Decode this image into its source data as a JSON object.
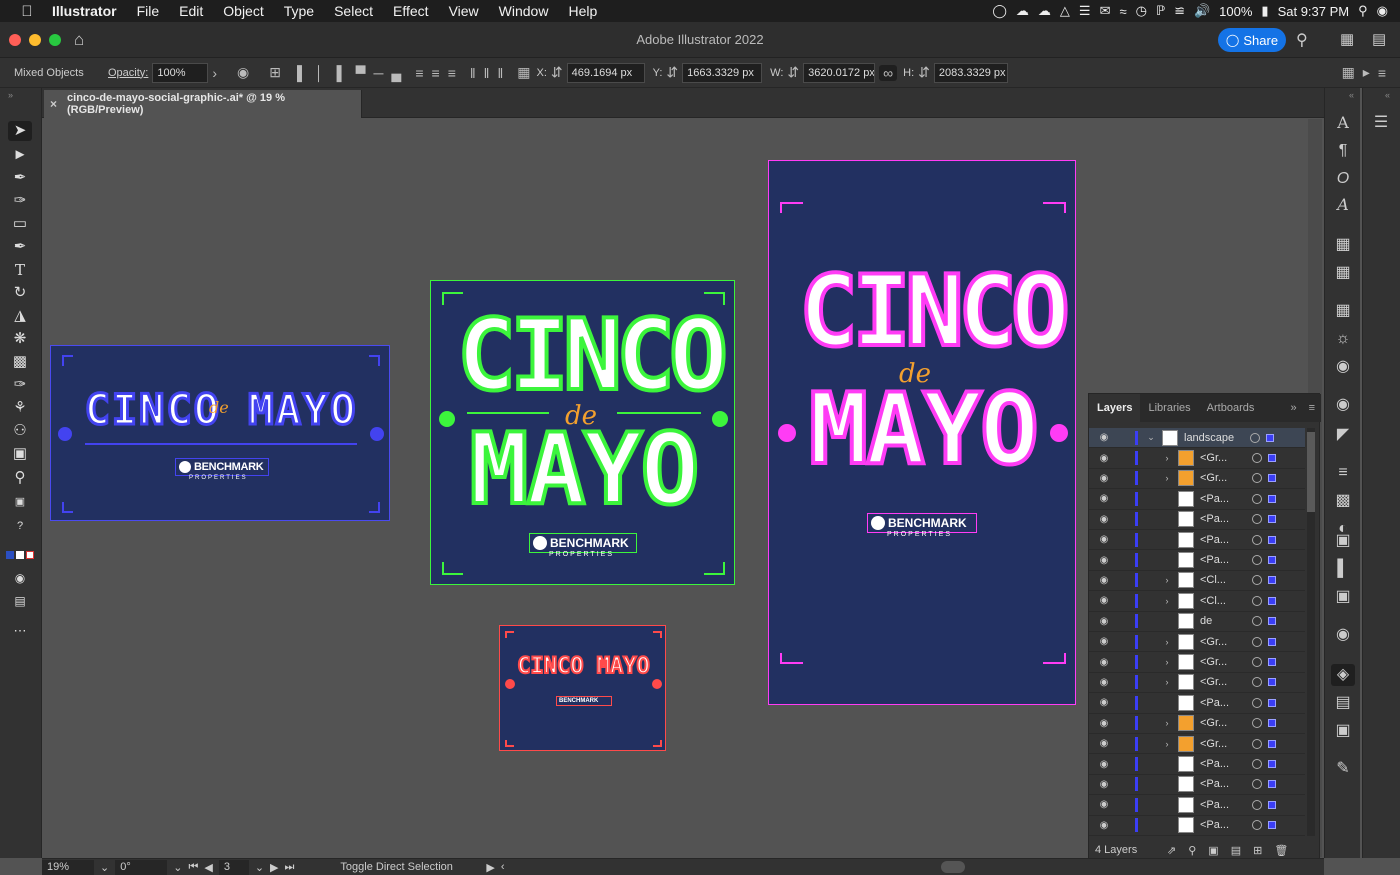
{
  "menubar": {
    "app": "Illustrator",
    "items": [
      "File",
      "Edit",
      "Object",
      "Type",
      "Select",
      "Effect",
      "View",
      "Window",
      "Help"
    ],
    "battery": "100%",
    "clock": "Sat 9:37 PM"
  },
  "titlebar": {
    "title": "Adobe Illustrator 2022",
    "share": "Share"
  },
  "control": {
    "selection_type": "Mixed Objects",
    "opacity_label": "Opacity:",
    "opacity_value": "100%",
    "x_label": "X:",
    "x_value": "469.1694 px",
    "y_label": "Y:",
    "y_value": "1663.3329 px",
    "w_label": "W:",
    "w_value": "3620.0172 px",
    "h_label": "H:",
    "h_value": "2083.3329 px"
  },
  "document": {
    "tab_title": "cinco-de-mayo-social-graphic-.ai* @ 19 % (RGB/Preview)"
  },
  "artwork": {
    "line1": "CINCO",
    "de": "de",
    "line2": "MAYO",
    "title_single": "CINCO MAYO",
    "logo_main": "BENCHMARK",
    "logo_sub": "PROPERTIES",
    "colors": {
      "bg": "#223061",
      "blue": "#4343f0",
      "green": "#3cf53c",
      "magenta": "#ff3cf5",
      "red": "#ff4a4a",
      "gold": "#f3a02e"
    }
  },
  "layers_panel": {
    "tabs": [
      "Layers",
      "Libraries",
      "Artboards"
    ],
    "rows": [
      {
        "name": "landscape",
        "kind": "layer",
        "expanded": true
      },
      {
        "name": "<Gr...",
        "thumb": "gold",
        "arrow": true
      },
      {
        "name": "<Gr...",
        "thumb": "gold",
        "arrow": true
      },
      {
        "name": "<Pa...",
        "thumb": "white",
        "arrow": false
      },
      {
        "name": "<Pa...",
        "thumb": "white",
        "arrow": false
      },
      {
        "name": "<Pa...",
        "thumb": "white",
        "arrow": false
      },
      {
        "name": "<Pa...",
        "thumb": "white",
        "arrow": false
      },
      {
        "name": "<Cl...",
        "thumb": "white",
        "arrow": true
      },
      {
        "name": "<Cl...",
        "thumb": "white",
        "arrow": true
      },
      {
        "name": "de",
        "thumb": "white",
        "arrow": false
      },
      {
        "name": "<Gr...",
        "thumb": "white",
        "arrow": true
      },
      {
        "name": "<Gr...",
        "thumb": "white",
        "arrow": true
      },
      {
        "name": "<Gr...",
        "thumb": "white",
        "arrow": true
      },
      {
        "name": "<Pa...",
        "thumb": "white",
        "arrow": false
      },
      {
        "name": "<Gr...",
        "thumb": "gold",
        "arrow": true
      },
      {
        "name": "<Gr...",
        "thumb": "gold",
        "arrow": true
      },
      {
        "name": "<Pa...",
        "thumb": "white",
        "arrow": false
      },
      {
        "name": "<Pa...",
        "thumb": "white",
        "arrow": false
      },
      {
        "name": "<Pa...",
        "thumb": "white",
        "arrow": false
      },
      {
        "name": "<Pa...",
        "thumb": "white",
        "arrow": false
      }
    ],
    "footer": "4 Layers"
  },
  "status": {
    "zoom": "19%",
    "rotation": "0°",
    "artboard": "3",
    "tool_hint": "Toggle Direct Selection"
  }
}
